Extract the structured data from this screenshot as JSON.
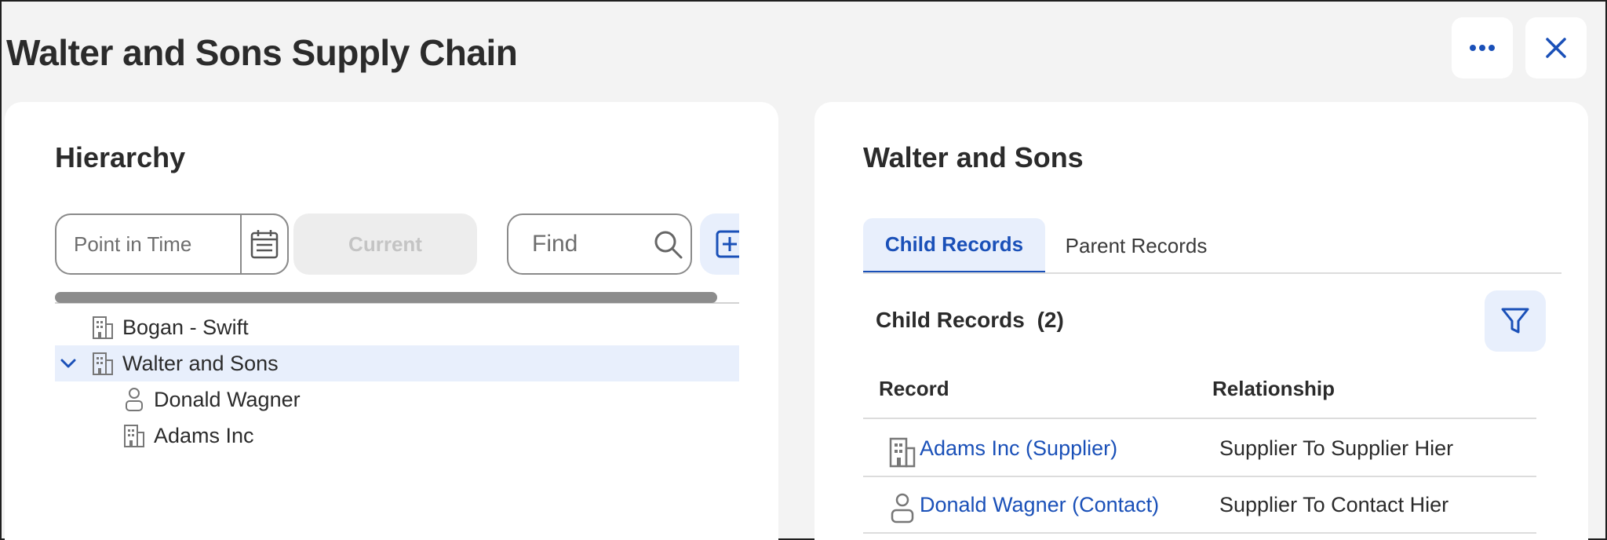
{
  "header": {
    "title": "Walter and Sons Supply Chain",
    "more_icon": "ellipsis-icon",
    "close_icon": "close-icon"
  },
  "hierarchy": {
    "title": "Hierarchy",
    "point_in_time_placeholder": "Point in Time",
    "current_label": "Current",
    "find_placeholder": "Find",
    "tree": [
      {
        "label": "Bogan - Swift",
        "icon": "building-icon",
        "level": 0,
        "expanded": false,
        "selected": false
      },
      {
        "label": "Walter and Sons",
        "icon": "building-icon",
        "level": 0,
        "expanded": true,
        "selected": true
      },
      {
        "label": "Donald Wagner",
        "icon": "person-icon",
        "level": 1,
        "expanded": false,
        "selected": false
      },
      {
        "label": "Adams Inc",
        "icon": "building-icon",
        "level": 1,
        "expanded": false,
        "selected": false
      }
    ]
  },
  "details": {
    "title": "Walter and Sons",
    "tabs": [
      {
        "label": "Child Records",
        "active": true
      },
      {
        "label": "Parent Records",
        "active": false
      }
    ],
    "section_title": "Child Records",
    "section_count": "(2)",
    "columns": {
      "record": "Record",
      "relationship": "Relationship"
    },
    "rows": [
      {
        "record": "Adams Inc (Supplier)",
        "icon": "building-icon",
        "relationship": "Supplier To Supplier Hier"
      },
      {
        "record": "Donald Wagner (Contact)",
        "icon": "person-icon",
        "relationship": "Supplier To Contact Hier"
      }
    ]
  },
  "colors": {
    "accent": "#1a50b8",
    "selected_bg": "#e8effc",
    "page_bg": "#f3f3f3"
  }
}
